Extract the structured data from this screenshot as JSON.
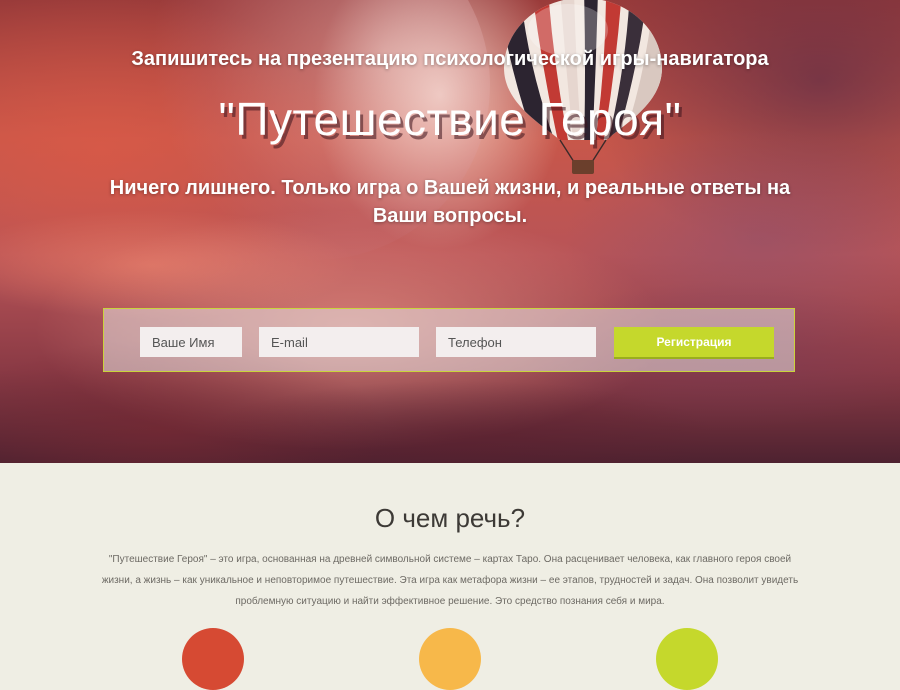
{
  "hero": {
    "subtitle": "Запишитесь на презентацию психологической игры-навигатора",
    "title": "\"Путешествие Героя\"",
    "tagline": "Ничего лишнего. Только игра о Вашей жизни, и реальные ответы на Ваши вопросы."
  },
  "form": {
    "name_placeholder": "Ваше Имя",
    "email_placeholder": "E-mail",
    "phone_placeholder": "Телефон",
    "submit_label": "Регистрация"
  },
  "about": {
    "title": "О чем речь?",
    "text": "\"Путешествие Героя\" – это игра, основанная на древней символьной системе – картах Таро. Она расценивает человека, как главного героя своей жизни, а жизнь – как уникальное и неповторимое путешествие. Эта игра как метафора жизни – ее этапов, трудностей и задач. Она позволит увидеть проблемную ситуацию и найти эффективное решение. Это средство познания себя и мира."
  },
  "colors": {
    "accent": "#c5d82c",
    "circle_red": "#d64a33",
    "circle_yellow": "#f7b84a",
    "circle_green": "#c5d82c",
    "section_bg": "#efeee4"
  }
}
